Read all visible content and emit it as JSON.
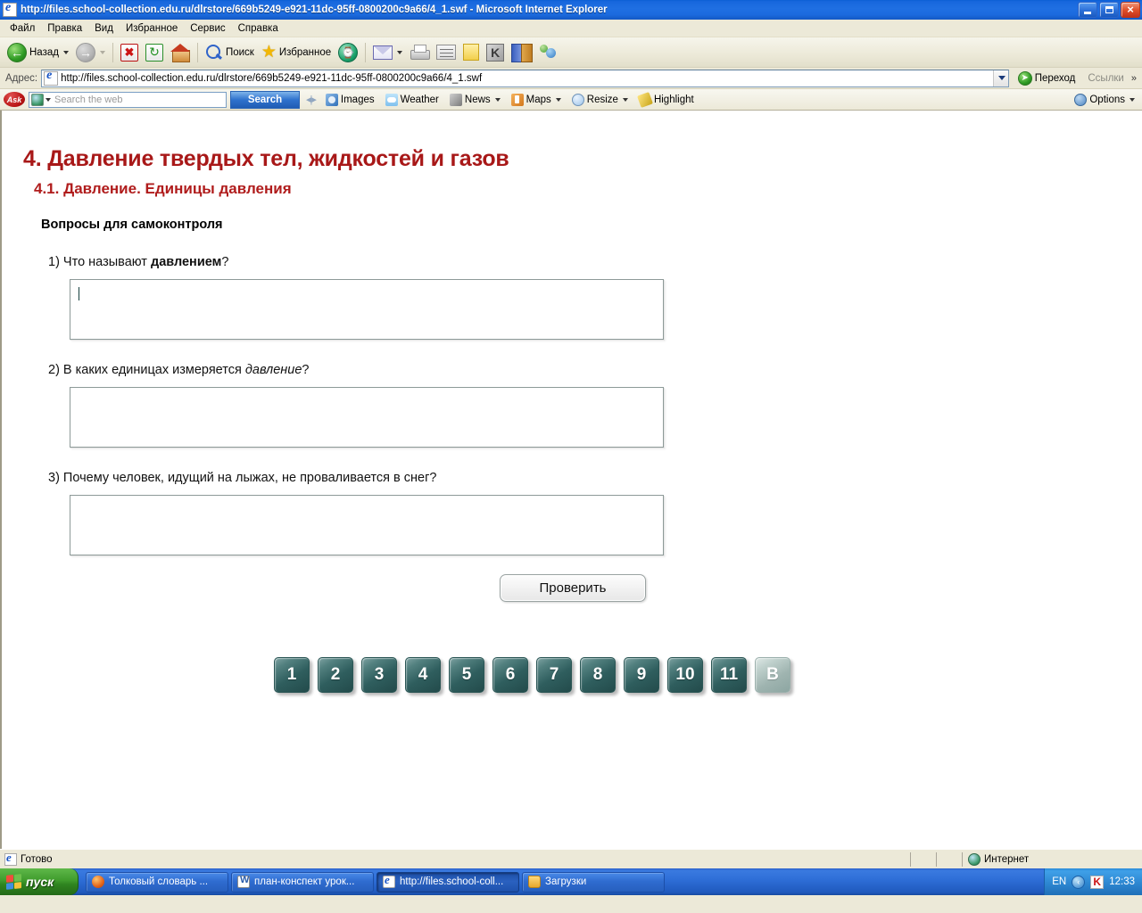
{
  "window": {
    "title": "http://files.school-collection.edu.ru/dlrstore/669b5249-e921-11dc-95ff-0800200c9a66/4_1.swf - Microsoft Internet Explorer",
    "icon": "ie-icon",
    "minimize_label": "_",
    "maximize_label": "",
    "close_label": "×"
  },
  "menu": {
    "items": [
      "Файл",
      "Правка",
      "Вид",
      "Избранное",
      "Сервис",
      "Справка"
    ]
  },
  "toolbar": {
    "back_label": "Назад",
    "forward_label": "",
    "stop_label": "",
    "refresh_label": "",
    "home_label": "",
    "search_label": "Поиск",
    "favorites_label": "Избранное",
    "history_label": "",
    "icons": [
      "back-icon",
      "forward-icon",
      "stop-icon",
      "refresh-icon",
      "home-icon",
      "search-icon",
      "favorites-star-icon",
      "history-icon",
      "mail-icon",
      "print-icon",
      "edit-icon",
      "notes-icon",
      "kaspersky-icon",
      "dictionary-icon",
      "messenger-icon"
    ]
  },
  "address": {
    "label": "Адрес:",
    "url": "http://files.school-collection.edu.ru/dlrstore/669b5249-e921-11dc-95ff-0800200c9a66/4_1.swf",
    "go_label": "Переход",
    "links_label": "Ссылки",
    "chevrons": "»"
  },
  "ask_toolbar": {
    "brand": "Ask",
    "search_placeholder": "Search the web",
    "search_button": "Search",
    "items": [
      {
        "label": "Images",
        "icon": "images-icon",
        "caret": false
      },
      {
        "label": "Weather",
        "icon": "weather-icon",
        "caret": false
      },
      {
        "label": "News",
        "icon": "news-icon",
        "caret": true
      },
      {
        "label": "Maps",
        "icon": "maps-icon",
        "caret": true
      },
      {
        "label": "Resize",
        "icon": "resize-icon",
        "caret": true
      },
      {
        "label": "Highlight",
        "icon": "highlight-icon",
        "caret": false
      }
    ],
    "options_label": "Options"
  },
  "page": {
    "chapter_title": "4. Давление твердых тел, жидкостей и газов",
    "section_title": "4.1. Давление. Единицы давления",
    "subheading": "Вопросы для самоконтроля",
    "questions": [
      {
        "number": "1)",
        "before": " Что называют ",
        "emphasis": "давлением",
        "emphasis_style": "bold",
        "after": "?",
        "answer_value": "",
        "has_caret": true
      },
      {
        "number": "2)",
        "before": " В каких единицах измеряется ",
        "emphasis": "давление",
        "emphasis_style": "italic",
        "after": "?",
        "answer_value": "",
        "has_caret": false
      },
      {
        "number": "3)",
        "before": " Почему человек, идущий на лыжах, не проваливается в снег?",
        "emphasis": "",
        "emphasis_style": "none",
        "after": "",
        "answer_value": "",
        "has_caret": false
      }
    ],
    "check_button": "Проверить",
    "nav_buttons": [
      "1",
      "2",
      "3",
      "4",
      "5",
      "6",
      "7",
      "8",
      "9",
      "10",
      "11",
      "B"
    ],
    "nav_current": "B",
    "colors": {
      "chapter_red": "#a81818",
      "section_red": "#b01c1c",
      "nav_button_teal": "#2f5e5e",
      "nav_button_current": "#9fb4b0"
    }
  },
  "statusbar": {
    "status_text": "Готово",
    "zone_text": "Интернет",
    "zone_icon": "globe-icon"
  },
  "taskbar": {
    "start_label": "пуск",
    "tasks": [
      {
        "label": "Толковый словарь ...",
        "icon": "firefox-icon",
        "active": false
      },
      {
        "label": "план-конспект урок...",
        "icon": "word-doc-icon",
        "active": false
      },
      {
        "label": "http://files.school-coll...",
        "icon": "ie-icon",
        "active": true
      },
      {
        "label": "Загрузки",
        "icon": "folder-icon",
        "active": false
      }
    ],
    "tray": {
      "language": "EN",
      "chevron": "‹",
      "kaspersky_icon": "kaspersky-tray-icon",
      "time": "12:33"
    }
  }
}
